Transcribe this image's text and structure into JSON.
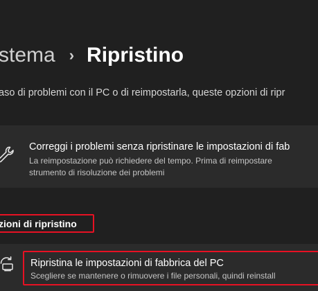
{
  "breadcrumb": {
    "parent": "stema",
    "separator": "›",
    "current": "Ripristino"
  },
  "description": "aso di problemi con il PC o di reimpostarla, queste opzioni di ripr",
  "troubleshoot_card": {
    "icon": "wrench-icon",
    "title": "Correggi i problemi senza ripristinare le impostazioni di fab",
    "description_line1": "La reimpostazione può richiedere del tempo. Prima di reimpostare",
    "description_line2": "strumento di risoluzione dei problemi"
  },
  "recovery_section": {
    "header": "zioni di ripristino",
    "highlight_color": "#e81123"
  },
  "reset_pc": {
    "icon": "reset-pc-icon",
    "title": "Ripristina le impostazioni di fabbrica del PC",
    "description": "Scegliere se mantenere o rimuovere i file personali, quindi reinstall"
  },
  "colors": {
    "background": "#202020",
    "card": "#2b2b2b",
    "text_primary": "#ffffff",
    "text_secondary": "#c5c5c5",
    "highlight": "#e81123"
  }
}
